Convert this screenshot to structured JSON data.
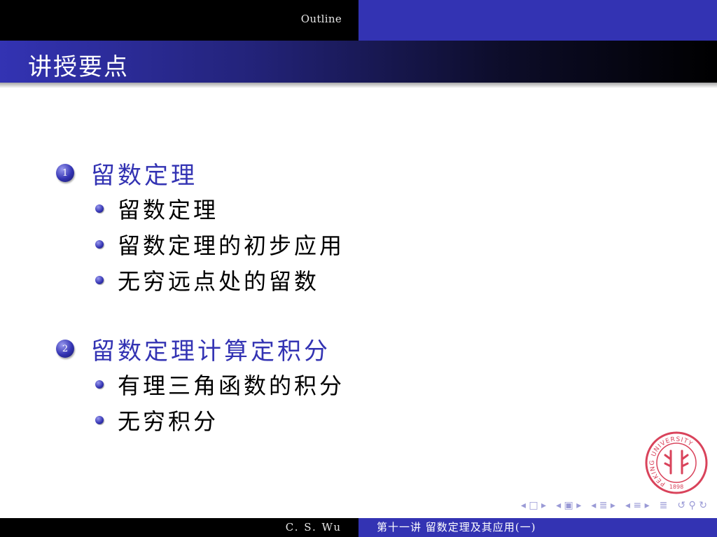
{
  "header": {
    "outline_label": "Outline",
    "frame_title": "讲授要点"
  },
  "sections": [
    {
      "number": "1",
      "title": "留数定理",
      "items": [
        "留数定理",
        "留数定理的初步应用",
        "无穷远点处的留数"
      ]
    },
    {
      "number": "2",
      "title": "留数定理计算定积分",
      "items": [
        "有理三角函数的积分",
        "无穷积分"
      ]
    }
  ],
  "footer": {
    "author": "C. S. Wu",
    "lecture": "第十一讲 留数定理及其应用(一)"
  },
  "logo": {
    "ring_text": "PEKING UNIVERSITY",
    "year": "1898"
  },
  "colors": {
    "beamer_blue": "#3333b3",
    "bar_black": "#000000",
    "logo_red": "#d9435b"
  }
}
